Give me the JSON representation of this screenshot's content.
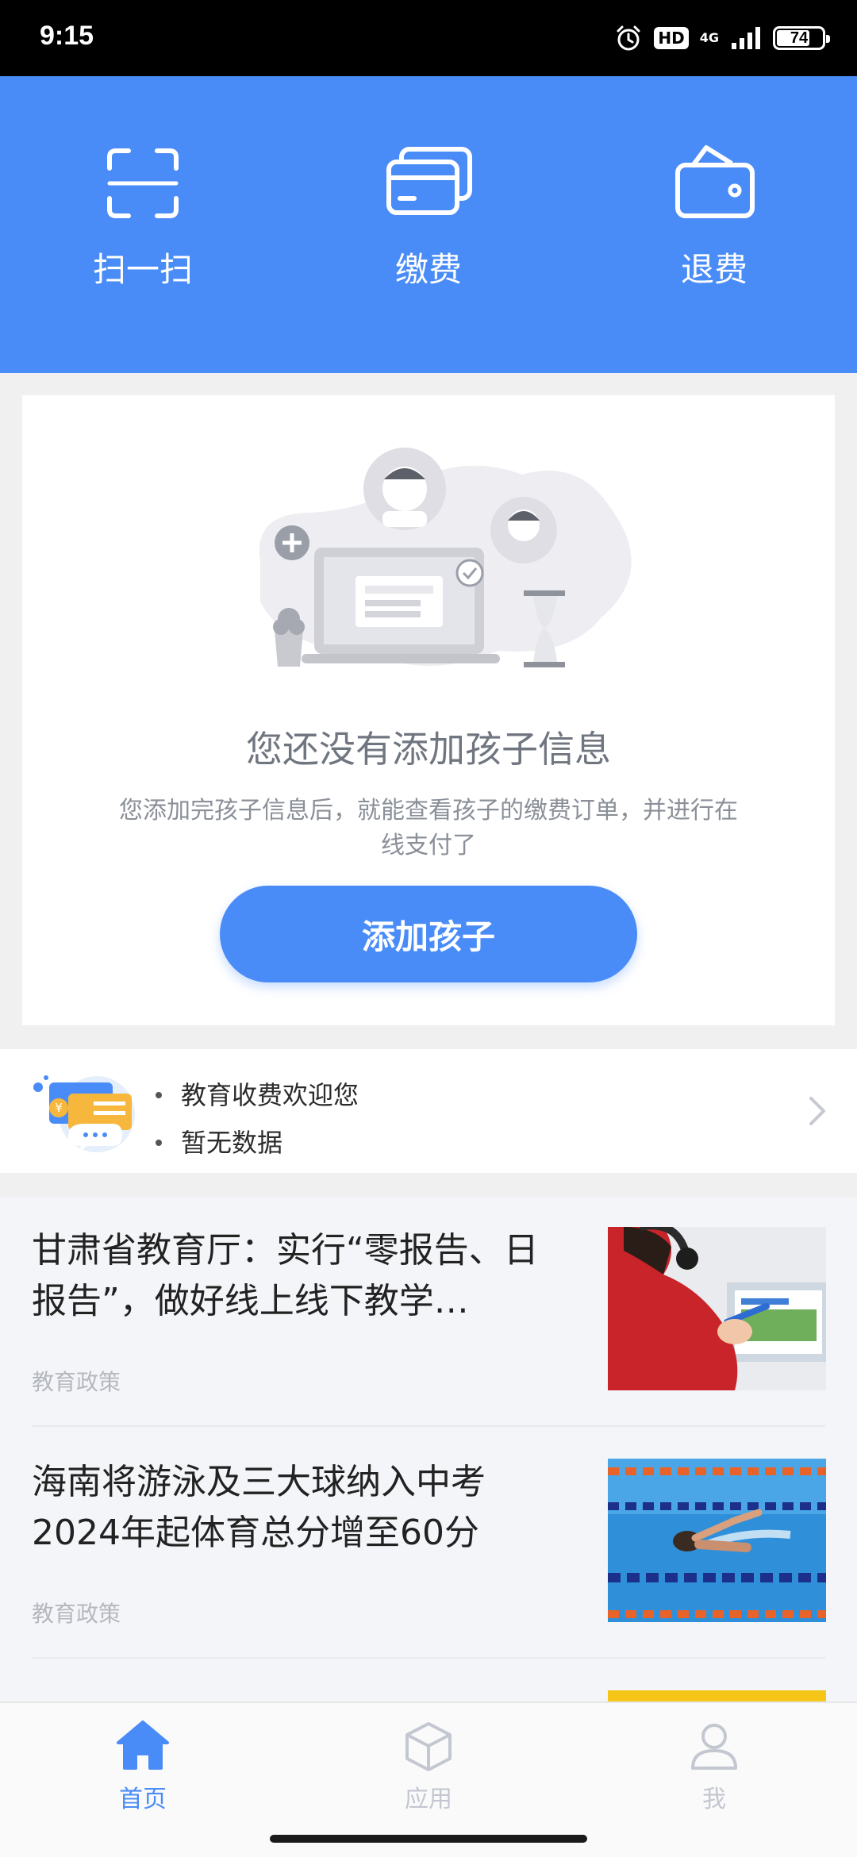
{
  "status_bar": {
    "time": "9:15",
    "hd": "HD",
    "network": "4G",
    "battery": "74",
    "battery_level": 0.74
  },
  "actions": [
    {
      "label": "扫一扫",
      "icon": "scan-icon"
    },
    {
      "label": "缴费",
      "icon": "card-icon"
    },
    {
      "label": "退费",
      "icon": "wallet-icon"
    }
  ],
  "empty_state": {
    "title": "您还没有添加孩子信息",
    "description": "您添加完孩子信息后，就能查看孩子的缴费订单，并进行在线支付了",
    "button_label": "添加孩子"
  },
  "notices": {
    "icon": "message-icon",
    "items": [
      "教育收费欢迎您",
      "暂无数据"
    ]
  },
  "news": [
    {
      "title": "甘肃省教育厅：实行“零报告、日报告”，做好线上线下教学…",
      "tag": "教育政策"
    },
    {
      "title": "海南将游泳及三大球纳入中考2024年起体育总分增至60分",
      "tag": "教育政策"
    }
  ],
  "bottom_nav": [
    {
      "label": "首页",
      "icon": "home-icon",
      "active": true
    },
    {
      "label": "应用",
      "icon": "cube-icon",
      "active": false
    },
    {
      "label": "我",
      "icon": "person-icon",
      "active": false
    }
  ],
  "colors": {
    "primary": "#4a8cf7",
    "inactive": "#c3c7d0"
  }
}
